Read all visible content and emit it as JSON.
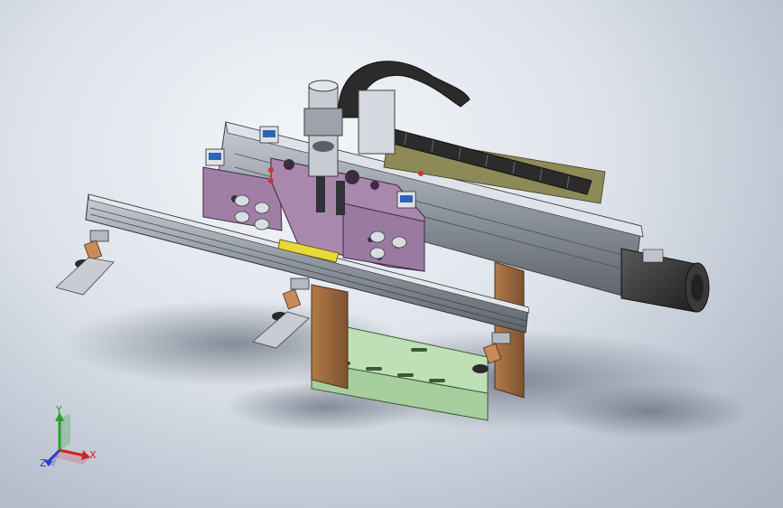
{
  "viewport": {
    "background_top": "#f4f6f9",
    "background_bottom": "#a9b2c0"
  },
  "triad": {
    "x_label": "X",
    "y_label": "Y",
    "z_label": "Z",
    "x_color": "#d22222",
    "y_color": "#27a02a",
    "z_color": "#2a3fd0"
  },
  "model": {
    "frame_color": "#a07fa6",
    "base_plate_color": "#a7cf9e",
    "wood_color": "#9c6a3c",
    "rail_color": "#8e949d",
    "chain_color": "#2b2b2b",
    "motor_color": "#3a3a3a",
    "highlight_bar_color": "#e8d93a",
    "sensor_color": "#2e64b8"
  }
}
